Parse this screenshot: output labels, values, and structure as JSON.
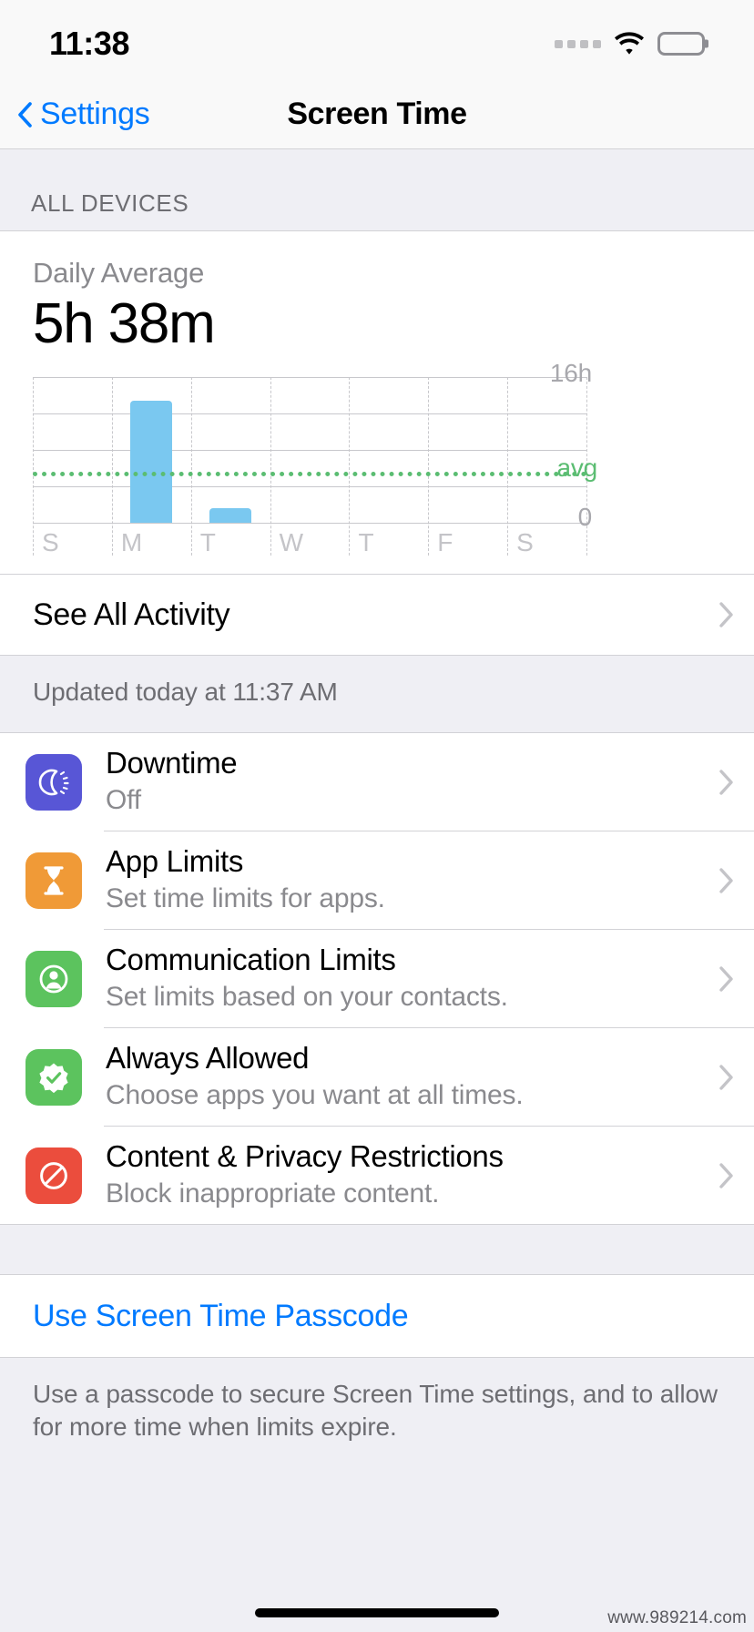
{
  "status_bar": {
    "time": "11:38",
    "signal_icon": "cellular-dots-icon",
    "wifi_icon": "wifi-icon",
    "battery_icon": "battery-full-icon"
  },
  "nav": {
    "back_icon": "chevron-left-icon",
    "back_label": "Settings",
    "title": "Screen Time"
  },
  "all_devices": {
    "section_header": "ALL DEVICES",
    "daily_average_label": "Daily Average",
    "daily_average_value": "5h 38m",
    "see_all_activity": "See All Activity",
    "see_all_chevron": "chevron-right-icon",
    "updated_footnote": "Updated today at 11:37 AM"
  },
  "chart_data": {
    "type": "bar",
    "title": "Daily Average",
    "categories": [
      "S",
      "M",
      "T",
      "W",
      "T",
      "F",
      "S"
    ],
    "values": [
      0,
      13.4,
      1.6,
      0,
      0,
      0,
      0
    ],
    "value_unit": "hours",
    "ylim": [
      0,
      16
    ],
    "ytick_labels": [
      "16h",
      "0"
    ],
    "yticks": [
      16,
      0
    ],
    "gridlines": [
      16,
      12,
      8,
      4,
      0
    ],
    "average_line": {
      "label": "avg",
      "value": 5.633,
      "color": "#5BBD72",
      "style": "dotted"
    },
    "bar_color": "#7AC8F0",
    "grid": true,
    "legend": "none",
    "xlabel": "",
    "ylabel": ""
  },
  "features": [
    {
      "id": "downtime",
      "title": "Downtime",
      "subtitle": "Off",
      "icon": "downtime-moon-icon",
      "icon_color": "#5856D6",
      "chevron": "chevron-right-icon"
    },
    {
      "id": "app-limits",
      "title": "App Limits",
      "subtitle": "Set time limits for apps.",
      "icon": "hourglass-icon",
      "icon_color": "#F09A37",
      "chevron": "chevron-right-icon"
    },
    {
      "id": "communication-limits",
      "title": "Communication Limits",
      "subtitle": "Set limits based on your contacts.",
      "icon": "person-circle-icon",
      "icon_color": "#5CC35E",
      "chevron": "chevron-right-icon"
    },
    {
      "id": "always-allowed",
      "title": "Always Allowed",
      "subtitle": "Choose apps you want at all times.",
      "icon": "checkmark-seal-icon",
      "icon_color": "#5CC35E",
      "chevron": "chevron-right-icon"
    },
    {
      "id": "content-privacy-restrictions",
      "title": "Content & Privacy Restrictions",
      "subtitle": "Block inappropriate content.",
      "icon": "prohibited-icon",
      "icon_color": "#EB4D3D",
      "chevron": "chevron-right-icon"
    }
  ],
  "passcode": {
    "link_label": "Use Screen Time Passcode",
    "footnote": "Use a passcode to secure Screen Time settings, and to allow for more time when limits expire."
  },
  "watermark": "www.989214.com",
  "colors": {
    "accent_blue": "#007AFF",
    "bar_blue": "#7AC8F0",
    "avg_green": "#5BBD72",
    "group_bg": "#EFEFF4",
    "separator": "#D2D2D6"
  }
}
